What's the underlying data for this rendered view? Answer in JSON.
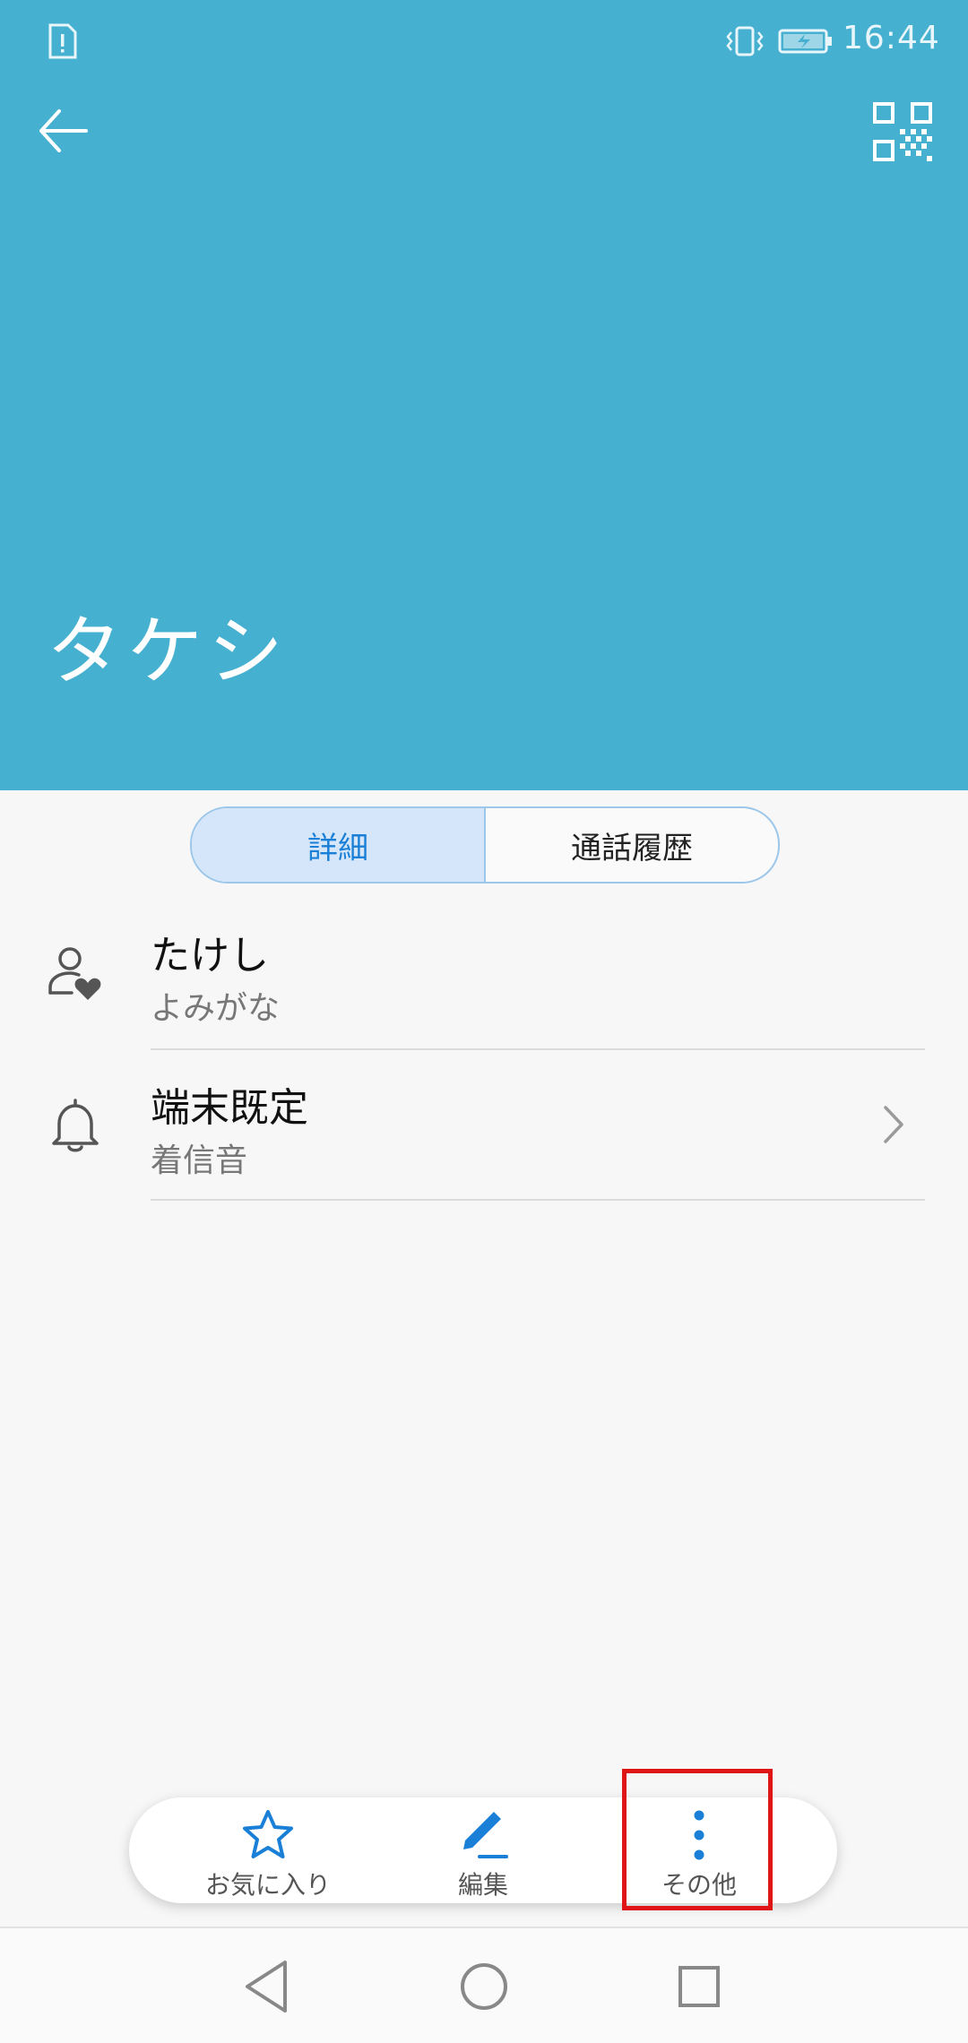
{
  "status_bar": {
    "time": "16:44",
    "icons": [
      "sim-alert-icon",
      "vibrate-icon",
      "battery-charging-icon"
    ]
  },
  "header": {
    "back_icon": "arrow-left-icon",
    "qr_icon": "qr-code-icon",
    "contact_name": "タケシ",
    "background_color": "#45b0cf"
  },
  "tabs": {
    "items": [
      {
        "label": "詳細",
        "active": true
      },
      {
        "label": "通話履歴",
        "active": false
      }
    ],
    "active_color": "#1a7fd6"
  },
  "details": {
    "rows": [
      {
        "icon": "person-heart-icon",
        "primary": "たけし",
        "secondary": "よみがな"
      },
      {
        "icon": "bell-icon",
        "primary": "端末既定",
        "secondary": "着信音",
        "trailing_icon": "chevron-right-icon"
      }
    ]
  },
  "bottom_actions": {
    "items": [
      {
        "icon": "star-icon",
        "label": "お気に入り"
      },
      {
        "icon": "pencil-icon",
        "label": "編集"
      },
      {
        "icon": "more-vertical-icon",
        "label": "その他"
      }
    ],
    "icon_color": "#1a7fd6",
    "highlight_color": "#e01515"
  },
  "navbar": {
    "icons": [
      "back-triangle-icon",
      "home-circle-icon",
      "recents-square-icon"
    ]
  }
}
